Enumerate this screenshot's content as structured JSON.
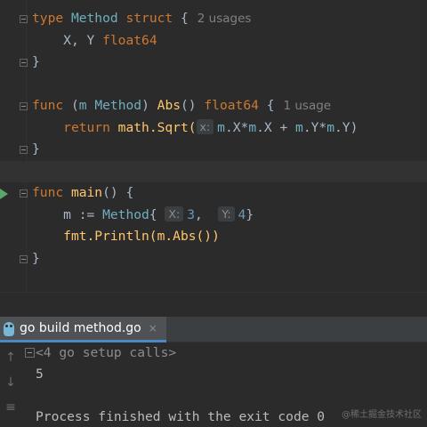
{
  "editor": {
    "lines": {
      "l1": {
        "kw": "type",
        "name": "Method",
        "kw2": "struct",
        "brace": "{",
        "usage": "2 usages"
      },
      "l2": {
        "text": "X, Y",
        "type": "float64"
      },
      "l3": {
        "text": "}"
      },
      "l5": {
        "kw": "func",
        "open": "(",
        "recv_var": "m",
        "recv_type": "Method",
        "close": ")",
        "fn": "Abs",
        "parens": "()",
        "ret": "float64",
        "brace": "{",
        "usage": "1 usage"
      },
      "l6": {
        "kw": "return",
        "call": "math.Sqrt(",
        "hint": "x:",
        "a1": "m",
        "a2": ".X*",
        "a3": "m",
        "a4": ".X + ",
        "a5": "m",
        "a6": ".Y*",
        "a7": "m",
        "a8": ".Y)"
      },
      "l7": {
        "text": "}"
      },
      "l9": {
        "kw": "func",
        "fn": "main",
        "rest": "() {"
      },
      "l10": {
        "a": "m := ",
        "type": "Method",
        "b": "{",
        "hint1": "X:",
        "v1": "3",
        "comma": ",",
        "hint2": "Y:",
        "v2": "4",
        "c": "}"
      },
      "l11": {
        "text": "fmt.Println(m.Abs())"
      },
      "l12": {
        "text": "}"
      }
    },
    "run_icon": "run-gutter-icon"
  },
  "run_panel": {
    "tab_label": "go build method.go",
    "tab_close": "×",
    "tab_icon": "gopher-icon",
    "tools": {
      "up": "↑",
      "down": "↓",
      "wrap": "≡"
    },
    "console": {
      "setup_calls": "<4 go setup calls>",
      "output": "5",
      "exit_message": "Process finished with the exit code 0"
    }
  },
  "watermark": "@稀土掘金技术社区",
  "colors": {
    "background": "#2b2b2b",
    "keyword": "#cc7832",
    "function": "#ffc66d",
    "type": "#6fafbd",
    "number": "#6897bb",
    "text": "#a9b7c6",
    "tab_underline": "#4a88c7"
  }
}
